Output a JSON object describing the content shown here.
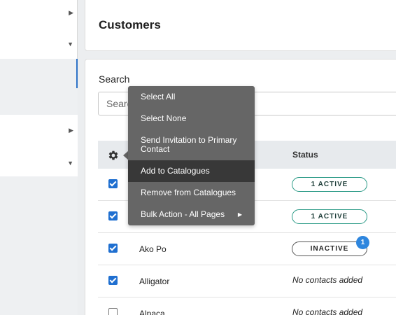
{
  "page": {
    "title": "Customers"
  },
  "search": {
    "label": "Search",
    "placeholder": "Search"
  },
  "table": {
    "columns": {
      "status": "Status"
    },
    "rows": [
      {
        "name": "",
        "status": "1 ACTIVE",
        "checked": true
      },
      {
        "name": "",
        "status": "1 ACTIVE",
        "checked": true
      },
      {
        "name": "Ako Po",
        "status": "INACTIVE",
        "badge": "1",
        "checked": true
      },
      {
        "name": "Alligator",
        "status": "No contacts added",
        "checked": true
      },
      {
        "name": "Alpaca",
        "status": "No contacts added",
        "checked": false
      }
    ]
  },
  "bulk_menu": {
    "items": [
      {
        "label": "Select All"
      },
      {
        "label": "Select None"
      },
      {
        "label": "Send Invitation to Primary Contact"
      },
      {
        "label": "Add to Catalogues",
        "highlighted": true
      },
      {
        "label": "Remove from Catalogues"
      },
      {
        "label": "Bulk Action - All Pages",
        "submenu_icon": "triangle-right-icon"
      }
    ]
  },
  "colors": {
    "accent": "#1f6fd0",
    "active_border": "#2a9a86",
    "menu_bg": "#666666",
    "menu_highlight": "#383838",
    "badge": "#2e86de"
  }
}
